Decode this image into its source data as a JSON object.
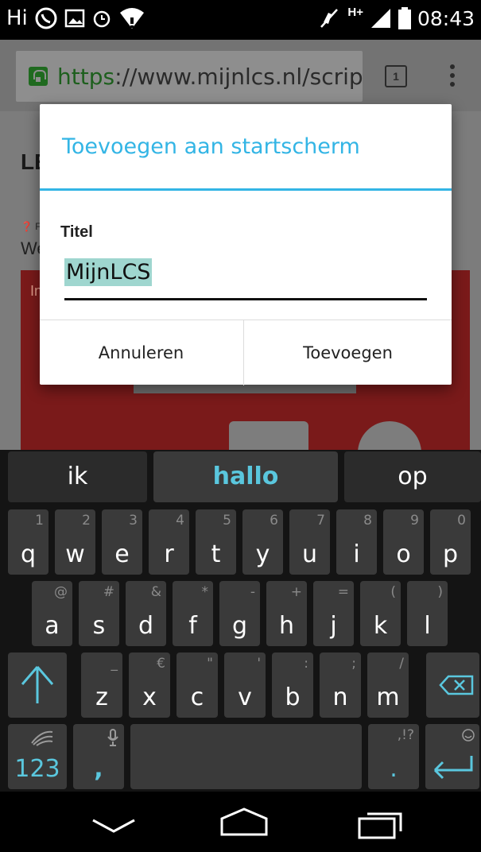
{
  "status_bar": {
    "carrier": "Hi",
    "network": "H+",
    "time": "08:43"
  },
  "browser": {
    "url_scheme": "https",
    "url_rest": "://www.mijnlcs.nl/scrip",
    "tab_count": "1"
  },
  "page_behind": {
    "heading": "LE",
    "snippet_small": "❓ F",
    "snippet": "We",
    "banner_text": "In"
  },
  "dialog": {
    "title": "Toevoegen aan startscherm",
    "field_label": "Titel",
    "field_value": "MijnLCS",
    "cancel_label": "Annuleren",
    "add_label": "Toevoegen"
  },
  "keyboard": {
    "suggestions": [
      "ik",
      "hallo",
      "op"
    ],
    "row1": [
      {
        "main": "q",
        "sec": "1"
      },
      {
        "main": "w",
        "sec": "2"
      },
      {
        "main": "e",
        "sec": "3"
      },
      {
        "main": "r",
        "sec": "4"
      },
      {
        "main": "t",
        "sec": "5"
      },
      {
        "main": "y",
        "sec": "6"
      },
      {
        "main": "u",
        "sec": "7"
      },
      {
        "main": "i",
        "sec": "8"
      },
      {
        "main": "o",
        "sec": "9"
      },
      {
        "main": "p",
        "sec": "0"
      }
    ],
    "row2": [
      {
        "main": "a",
        "sec": "@"
      },
      {
        "main": "s",
        "sec": "#"
      },
      {
        "main": "d",
        "sec": "&"
      },
      {
        "main": "f",
        "sec": "*"
      },
      {
        "main": "g",
        "sec": "-"
      },
      {
        "main": "h",
        "sec": "+"
      },
      {
        "main": "j",
        "sec": "="
      },
      {
        "main": "k",
        "sec": "("
      },
      {
        "main": "l",
        "sec": ")"
      }
    ],
    "row3": [
      {
        "main": "z",
        "sec": "_"
      },
      {
        "main": "x",
        "sec": "€"
      },
      {
        "main": "c",
        "sec": "\""
      },
      {
        "main": "v",
        "sec": "'"
      },
      {
        "main": "b",
        "sec": ":"
      },
      {
        "main": "n",
        "sec": ";"
      },
      {
        "main": "m",
        "sec": "/"
      }
    ],
    "symbols_label": "123",
    "comma_label": ",",
    "period_label": ".",
    "period_sec": ",!?"
  },
  "colors": {
    "accent": "#33b5e5",
    "suggestion_highlight": "#5ac7de",
    "selection": "#9fd6cf"
  }
}
